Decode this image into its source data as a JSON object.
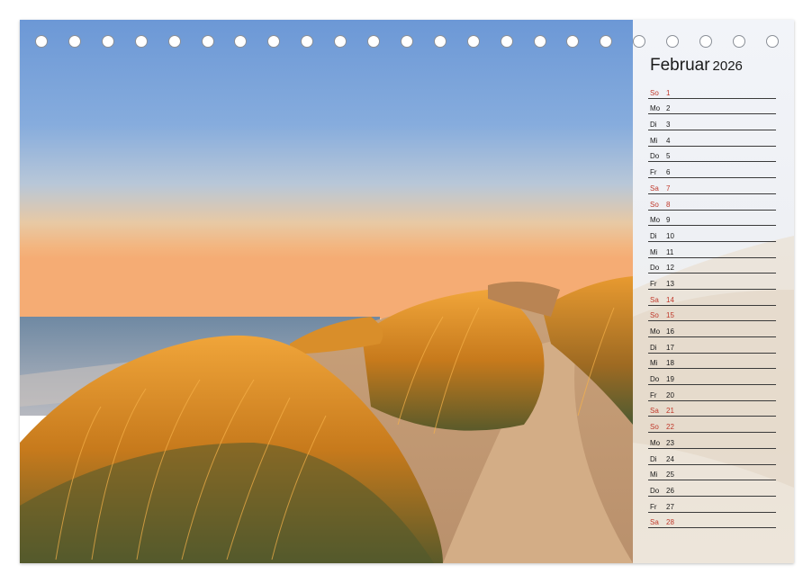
{
  "calendar": {
    "month": "Februar",
    "year": "2026",
    "ring_count": 23,
    "colors": {
      "weekend": "#c0392b",
      "weekday": "#1a1a1a"
    },
    "days": [
      {
        "weekday": "So",
        "day": "1",
        "weekend": true
      },
      {
        "weekday": "Mo",
        "day": "2",
        "weekend": false
      },
      {
        "weekday": "Di",
        "day": "3",
        "weekend": false
      },
      {
        "weekday": "Mi",
        "day": "4",
        "weekend": false
      },
      {
        "weekday": "Do",
        "day": "5",
        "weekend": false
      },
      {
        "weekday": "Fr",
        "day": "6",
        "weekend": false
      },
      {
        "weekday": "Sa",
        "day": "7",
        "weekend": true
      },
      {
        "weekday": "So",
        "day": "8",
        "weekend": true
      },
      {
        "weekday": "Mo",
        "day": "9",
        "weekend": false
      },
      {
        "weekday": "Di",
        "day": "10",
        "weekend": false
      },
      {
        "weekday": "Mi",
        "day": "11",
        "weekend": false
      },
      {
        "weekday": "Do",
        "day": "12",
        "weekend": false
      },
      {
        "weekday": "Fr",
        "day": "13",
        "weekend": false
      },
      {
        "weekday": "Sa",
        "day": "14",
        "weekend": true
      },
      {
        "weekday": "So",
        "day": "15",
        "weekend": true
      },
      {
        "weekday": "Mo",
        "day": "16",
        "weekend": false
      },
      {
        "weekday": "Di",
        "day": "17",
        "weekend": false
      },
      {
        "weekday": "Mi",
        "day": "18",
        "weekend": false
      },
      {
        "weekday": "Do",
        "day": "19",
        "weekend": false
      },
      {
        "weekday": "Fr",
        "day": "20",
        "weekend": false
      },
      {
        "weekday": "Sa",
        "day": "21",
        "weekend": true
      },
      {
        "weekday": "So",
        "day": "22",
        "weekend": true
      },
      {
        "weekday": "Mo",
        "day": "23",
        "weekend": false
      },
      {
        "weekday": "Di",
        "day": "24",
        "weekend": false
      },
      {
        "weekday": "Mi",
        "day": "25",
        "weekend": false
      },
      {
        "weekday": "Do",
        "day": "26",
        "weekend": false
      },
      {
        "weekday": "Fr",
        "day": "27",
        "weekend": false
      },
      {
        "weekday": "Sa",
        "day": "28",
        "weekend": true
      }
    ]
  }
}
